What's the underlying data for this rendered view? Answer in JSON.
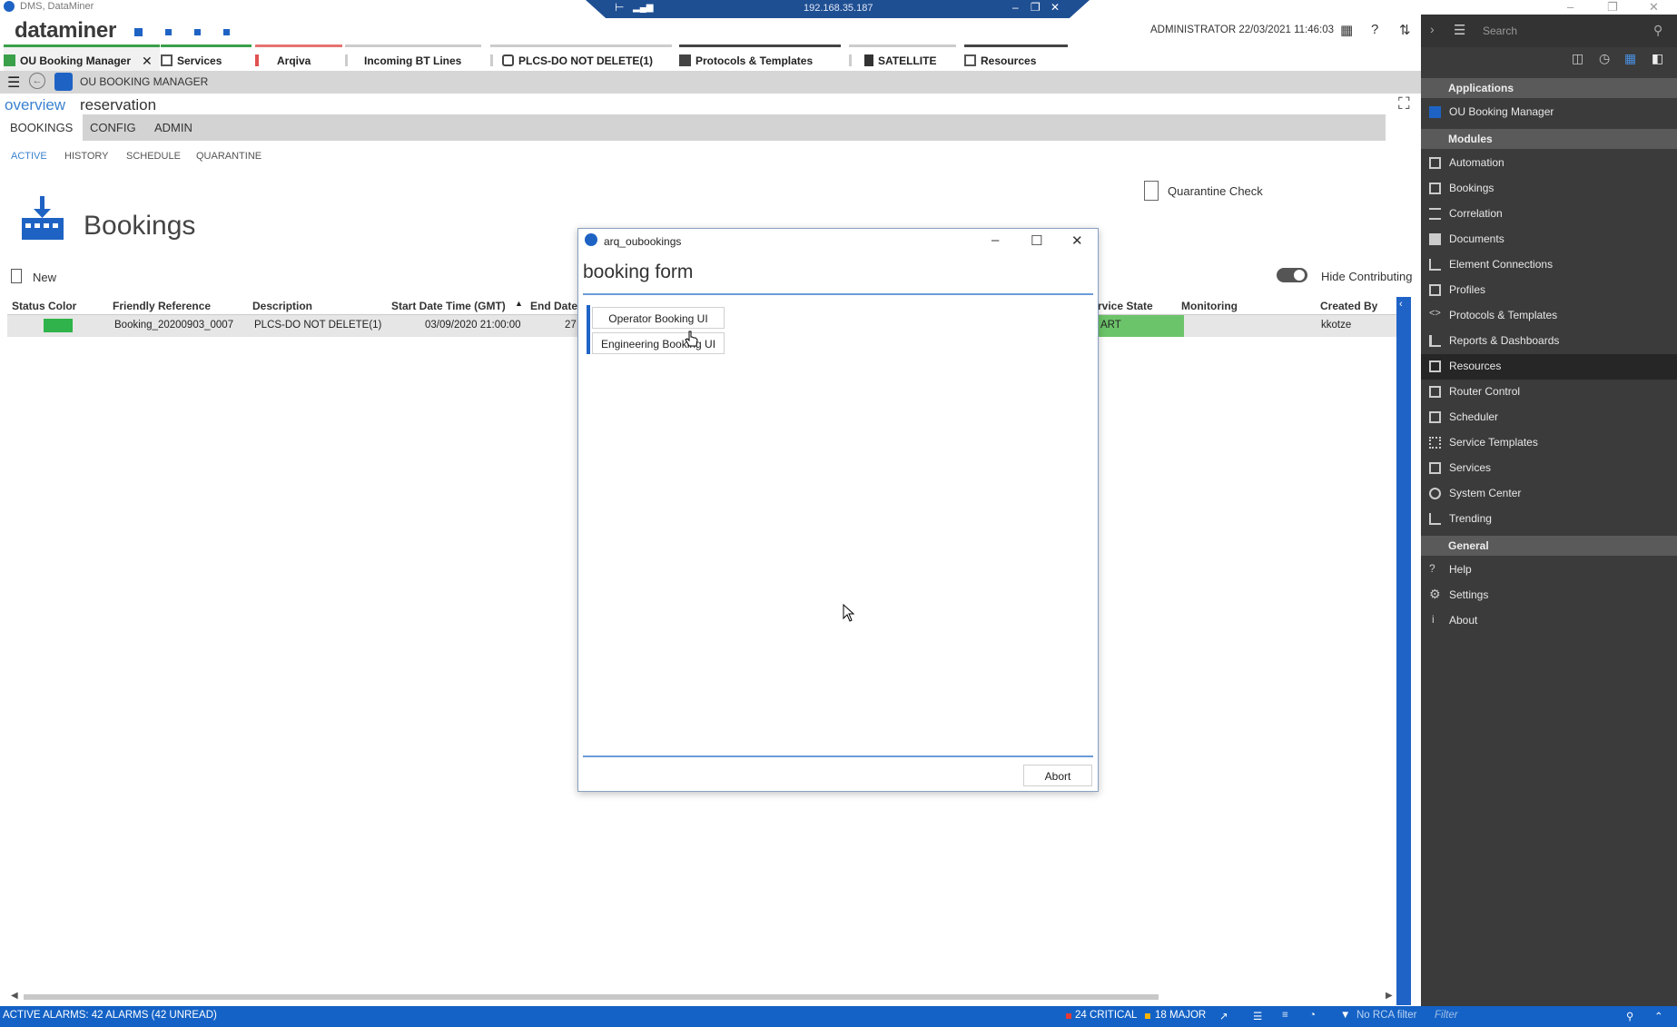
{
  "window": {
    "title": "DMS, DataMiner",
    "remote_ip": "192.168.35.187"
  },
  "header": {
    "logo": "dataminer",
    "user_info": "ADMINISTRATOR 22/03/2021 11:46:03"
  },
  "tabs": [
    {
      "label": "OU Booking Manager",
      "accent": "#3aa04a"
    },
    {
      "label": "Services",
      "accent": "#3aa04a"
    },
    {
      "label": "Arqiva",
      "accent": "#e57373"
    },
    {
      "label": "Incoming BT Lines",
      "accent": "#cccccc"
    },
    {
      "label": "PLCS-DO NOT DELETE(1)",
      "accent": "#cccccc"
    },
    {
      "label": "Protocols & Templates",
      "accent": "#444444"
    },
    {
      "label": "SATELLITE",
      "accent": "#cccccc"
    },
    {
      "label": "Resources",
      "accent": "#444444"
    }
  ],
  "breadcrumb": {
    "label": "OU BOOKING MANAGER"
  },
  "topnav": {
    "overview": "overview",
    "reservation": "reservation"
  },
  "mainnav": [
    "BOOKINGS",
    "CONFIG",
    "ADMIN"
  ],
  "subnav": [
    "ACTIVE",
    "HISTORY",
    "SCHEDULE",
    "QUARANTINE"
  ],
  "page": {
    "title": "Bookings",
    "quarantine_check": "Quarantine Check",
    "new_label": "New",
    "hide_contributing": "Hide Contributing"
  },
  "table": {
    "columns": [
      "Status Color",
      "Friendly Reference",
      "Description",
      "Start Date Time (GMT)",
      "End Date",
      "rvice State",
      "Monitoring",
      "Created By"
    ],
    "row": {
      "friendly_reference": "Booking_20200903_0007",
      "description": "PLCS-DO NOT DELETE(1)",
      "start": "03/09/2020 21:00:00",
      "end": "27",
      "service_state": "ART",
      "created_by": "kkotze",
      "status_color": "#2fb34a"
    }
  },
  "statusbar": {
    "alarms": "ACTIVE ALARMS: 42 ALARMS (42 UNREAD)",
    "critical": "24 CRITICAL",
    "major": "18 MAJOR",
    "rca": "No RCA filter",
    "filter_placeholder": "Filter"
  },
  "sidepanel": {
    "search_placeholder": "Search",
    "applications_header": "Applications",
    "applications": [
      "OU Booking Manager"
    ],
    "modules_header": "Modules",
    "modules": [
      "Automation",
      "Bookings",
      "Correlation",
      "Documents",
      "Element Connections",
      "Profiles",
      "Protocols & Templates",
      "Reports & Dashboards",
      "Resources",
      "Router Control",
      "Scheduler",
      "Service Templates",
      "Services",
      "System Center",
      "Trending"
    ],
    "general_header": "General",
    "general": [
      "Help",
      "Settings",
      "About"
    ]
  },
  "dialog": {
    "title": "arq_oubookings",
    "heading": "booking form",
    "buttons": [
      "Operator Booking UI",
      "Engineering Booking UI"
    ],
    "abort": "Abort"
  }
}
